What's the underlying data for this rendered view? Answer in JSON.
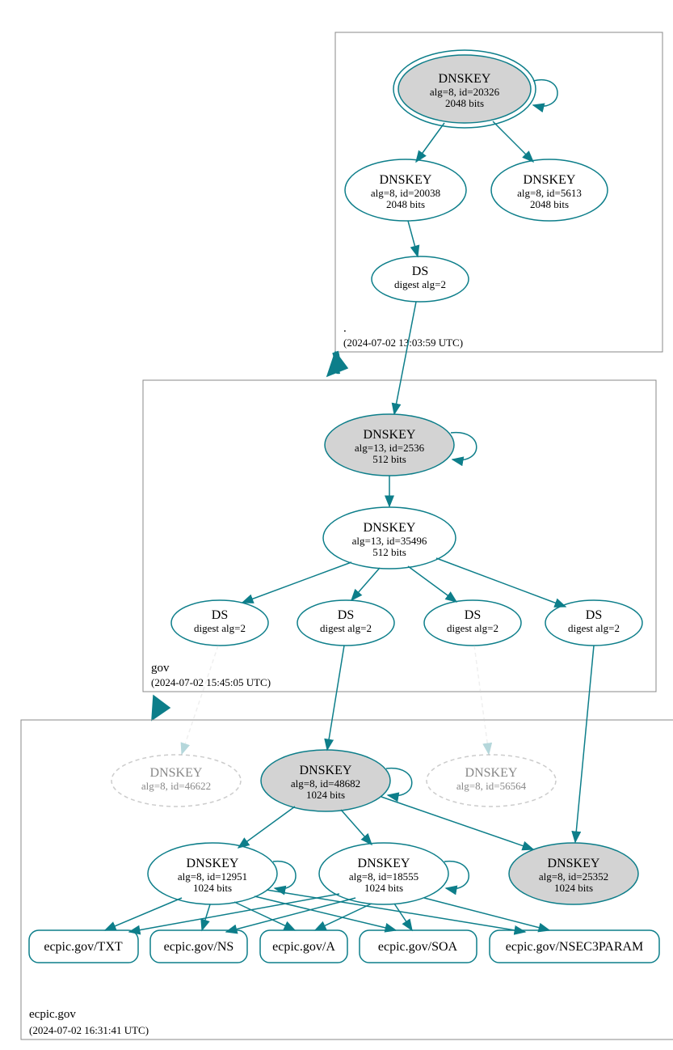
{
  "colors": {
    "teal": "#0d7e8a",
    "fill": "#d3d3d3",
    "dashed": "#cccccc"
  },
  "zones": {
    "root": {
      "label": ".",
      "timestamp": "(2024-07-02 13:03:59 UTC)"
    },
    "gov": {
      "label": "gov",
      "timestamp": "(2024-07-02 15:45:05 UTC)"
    },
    "ecpic": {
      "label": "ecpic.gov",
      "timestamp": "(2024-07-02 16:31:41 UTC)"
    }
  },
  "nodes": {
    "root_ksk": {
      "title": "DNSKEY",
      "line1": "alg=8, id=20326",
      "line2": "2048 bits"
    },
    "root_zsk1": {
      "title": "DNSKEY",
      "line1": "alg=8, id=20038",
      "line2": "2048 bits"
    },
    "root_zsk2": {
      "title": "DNSKEY",
      "line1": "alg=8, id=5613",
      "line2": "2048 bits"
    },
    "root_ds": {
      "title": "DS",
      "line1": "digest alg=2"
    },
    "gov_ksk": {
      "title": "DNSKEY",
      "line1": "alg=13, id=2536",
      "line2": "512 bits"
    },
    "gov_zsk": {
      "title": "DNSKEY",
      "line1": "alg=13, id=35496",
      "line2": "512 bits"
    },
    "gov_ds1": {
      "title": "DS",
      "line1": "digest alg=2"
    },
    "gov_ds2": {
      "title": "DS",
      "line1": "digest alg=2"
    },
    "gov_ds3": {
      "title": "DS",
      "line1": "digest alg=2"
    },
    "gov_ds4": {
      "title": "DS",
      "line1": "digest alg=2"
    },
    "ecpic_d1": {
      "title": "DNSKEY",
      "line1": "alg=8, id=46622"
    },
    "ecpic_ksk": {
      "title": "DNSKEY",
      "line1": "alg=8, id=48682",
      "line2": "1024 bits"
    },
    "ecpic_d2": {
      "title": "DNSKEY",
      "line1": "alg=8, id=56564"
    },
    "ecpic_zsk1": {
      "title": "DNSKEY",
      "line1": "alg=8, id=12951",
      "line2": "1024 bits"
    },
    "ecpic_zsk2": {
      "title": "DNSKEY",
      "line1": "alg=8, id=18555",
      "line2": "1024 bits"
    },
    "ecpic_ksk2": {
      "title": "DNSKEY",
      "line1": "alg=8, id=25352",
      "line2": "1024 bits"
    }
  },
  "records": {
    "txt": "ecpic.gov/TXT",
    "ns": "ecpic.gov/NS",
    "a": "ecpic.gov/A",
    "soa": "ecpic.gov/SOA",
    "nsec3": "ecpic.gov/NSEC3PARAM"
  }
}
